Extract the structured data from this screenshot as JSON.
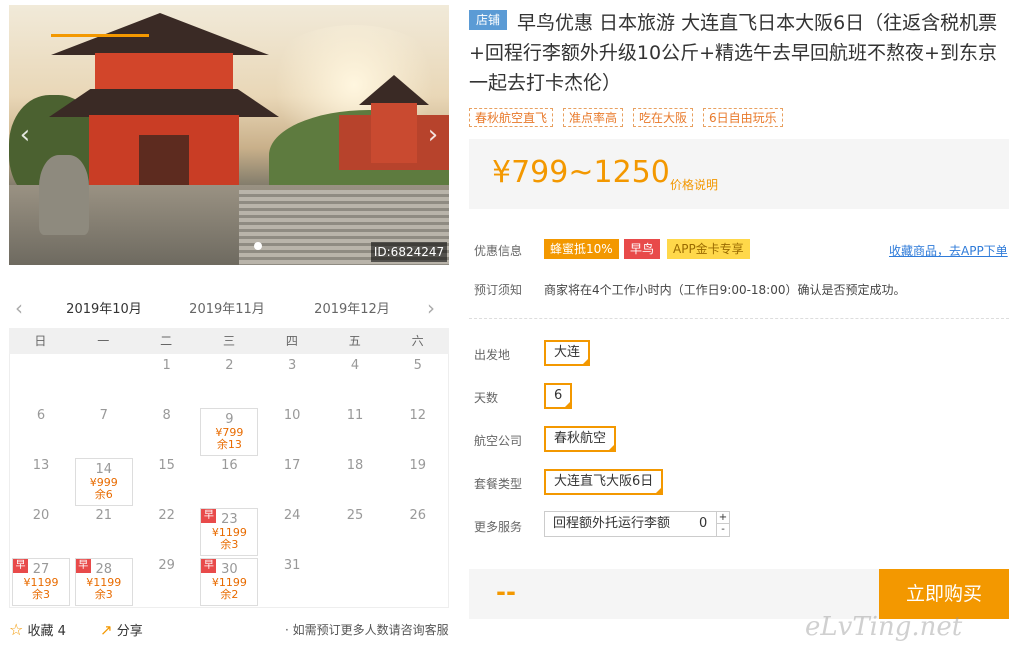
{
  "hero": {
    "id_label": "ID:6824247",
    "prev_icon": "‹",
    "next_icon": "›"
  },
  "calendar": {
    "months": [
      "2019年10月",
      "2019年11月",
      "2019年12月"
    ],
    "weekdays": [
      "日",
      "一",
      "二",
      "三",
      "四",
      "五",
      "六"
    ],
    "early_tag": "早",
    "days": [
      {
        "d": "1"
      },
      {
        "d": "2"
      },
      {
        "d": "3"
      },
      {
        "d": "4"
      },
      {
        "d": "5"
      },
      {
        "d": "6"
      },
      {
        "d": "7"
      },
      {
        "d": "8"
      },
      {
        "d": "9",
        "price": "¥799",
        "rest": "余13"
      },
      {
        "d": "10"
      },
      {
        "d": "11"
      },
      {
        "d": "12"
      },
      {
        "d": "13"
      },
      {
        "d": "14",
        "price": "¥999",
        "rest": "余6"
      },
      {
        "d": "15"
      },
      {
        "d": "16"
      },
      {
        "d": "17"
      },
      {
        "d": "18"
      },
      {
        "d": "19"
      },
      {
        "d": "20"
      },
      {
        "d": "21"
      },
      {
        "d": "22"
      },
      {
        "d": "23",
        "price": "¥1199",
        "rest": "余3",
        "early": true
      },
      {
        "d": "24"
      },
      {
        "d": "25"
      },
      {
        "d": "26"
      },
      {
        "d": "27",
        "price": "¥1199",
        "rest": "余3",
        "early": true
      },
      {
        "d": "28",
        "price": "¥1199",
        "rest": "余3",
        "early": true
      },
      {
        "d": "29"
      },
      {
        "d": "30",
        "price": "¥1199",
        "rest": "余2",
        "early": true
      },
      {
        "d": "31"
      }
    ]
  },
  "footer": {
    "fav": "收藏 4",
    "share": "分享",
    "consult": "· 如需预订更多人数请咨询客服"
  },
  "product": {
    "badge": "店铺",
    "title": "早鸟优惠 日本旅游 大连直飞日本大阪6日（往返含税机票+回程行李额外升级10公斤+精选午去早回航班不熬夜+到东京一起去打卡杰伦）",
    "tags": [
      "春秋航空直飞",
      "准点率高",
      "吃在大阪",
      "6日自由玩乐"
    ],
    "price": "¥799~1250",
    "price_note": "价格说明"
  },
  "promo": {
    "label": "优惠信息",
    "pills": [
      "蜂蜜抵10%",
      "早鸟",
      "APP金卡专享"
    ],
    "link": "收藏商品，去APP下单"
  },
  "notice": {
    "label": "预订须知",
    "text": "商家将在4个工作小时内（工作日9:00-18:00）确认是否预定成功。"
  },
  "options": {
    "origin_label": "出发地",
    "origin": "大连",
    "days_label": "天数",
    "days": "6",
    "airline_label": "航空公司",
    "airline": "春秋航空",
    "package_label": "套餐类型",
    "package": "大连直飞大阪6日",
    "service_label": "更多服务",
    "service": "回程额外托运行李额",
    "service_qty": "0"
  },
  "buy": {
    "price": "--",
    "button": "立即购买"
  },
  "watermark": "eLvTing.net",
  "colors": {
    "accent": "#f39800",
    "early": "#e84a4a",
    "link": "#2f7bd9"
  }
}
